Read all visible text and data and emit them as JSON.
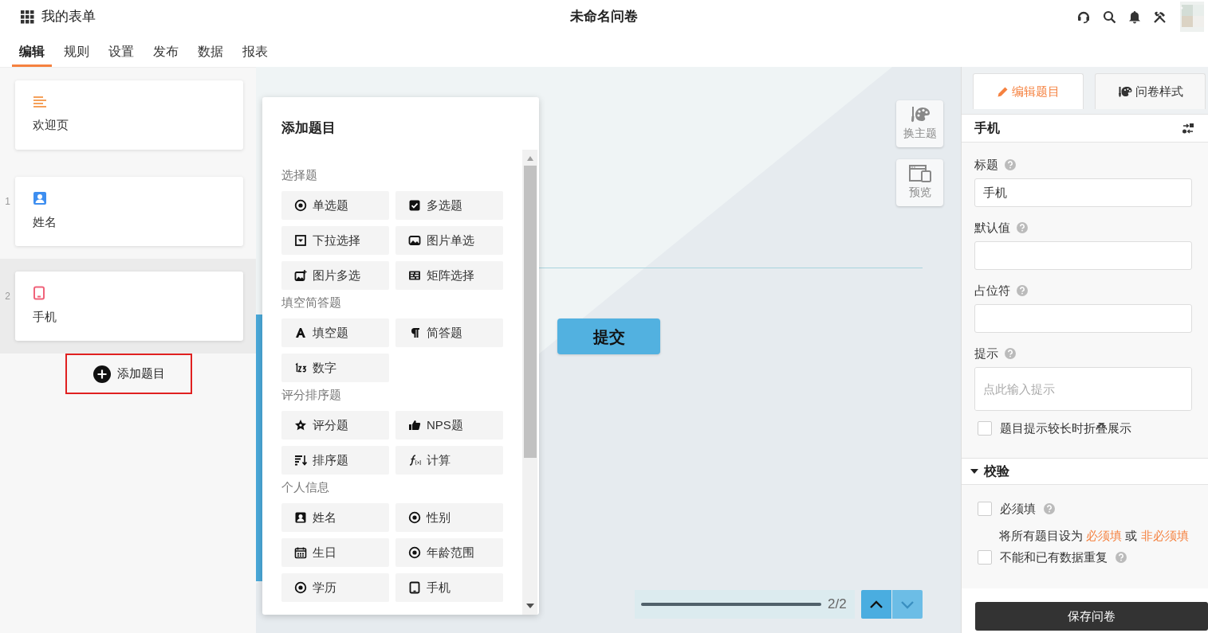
{
  "header": {
    "app_title": "我的表单",
    "survey_title": "未命名问卷"
  },
  "tabs": [
    {
      "label": "编辑",
      "selected": true
    },
    {
      "label": "规则",
      "selected": false
    },
    {
      "label": "设置",
      "selected": false
    },
    {
      "label": "发布",
      "selected": false
    },
    {
      "label": "数据",
      "selected": false
    },
    {
      "label": "报表",
      "selected": false
    }
  ],
  "pages": [
    {
      "kind": "welcome",
      "label": "欢迎页",
      "color": "#f5a05a",
      "selected": false
    },
    {
      "kind": "name",
      "number": "1",
      "label": "姓名",
      "color": "#3d8ef0",
      "selected": false
    },
    {
      "kind": "phone",
      "number": "2",
      "label": "手机",
      "color": "#f0637a",
      "selected": true
    }
  ],
  "add_button": "添加题目",
  "picker": {
    "title": "添加题目",
    "groups": [
      {
        "title": "选择题",
        "items": [
          {
            "kind": "radio",
            "label": "单选题"
          },
          {
            "kind": "checkbox",
            "label": "多选题"
          },
          {
            "kind": "dropdown",
            "label": "下拉选择"
          },
          {
            "kind": "image",
            "label": "图片单选"
          },
          {
            "kind": "images",
            "label": "图片多选"
          },
          {
            "kind": "matrix",
            "label": "矩阵选择"
          }
        ]
      },
      {
        "title": "填空简答题",
        "items": [
          {
            "kind": "text",
            "label": "填空题"
          },
          {
            "kind": "paragraph",
            "label": "简答题"
          },
          {
            "kind": "number",
            "label": "数字"
          }
        ]
      },
      {
        "title": "评分排序题",
        "items": [
          {
            "kind": "star",
            "label": "评分题"
          },
          {
            "kind": "thumb",
            "label": "NPS题"
          },
          {
            "kind": "sort",
            "label": "排序题"
          },
          {
            "kind": "formula",
            "label": "计算"
          }
        ]
      },
      {
        "title": "个人信息",
        "items": [
          {
            "kind": "person",
            "label": "姓名"
          },
          {
            "kind": "radio",
            "label": "性别"
          },
          {
            "kind": "calendar",
            "label": "生日"
          },
          {
            "kind": "radio",
            "label": "年龄范围"
          },
          {
            "kind": "radio",
            "label": "学历"
          },
          {
            "kind": "phone",
            "label": "手机"
          }
        ]
      }
    ]
  },
  "canvas": {
    "tools": [
      {
        "kind": "theme",
        "label": "换主题"
      },
      {
        "kind": "preview",
        "label": "预览"
      }
    ],
    "submit_button": "提交",
    "progress": {
      "level": 1,
      "reading": "2/2"
    },
    "pager": [
      {
        "kind": "up",
        "disabled": false
      },
      {
        "kind": "down",
        "disabled": true
      }
    ]
  },
  "editor": {
    "tabs": [
      {
        "kind": "edit",
        "label": "编辑题目",
        "selected": true
      },
      {
        "kind": "style",
        "label": "问卷样式",
        "selected": false
      }
    ],
    "question_title": "手机",
    "fields": [
      {
        "kind": "line",
        "label": "标题",
        "value": "手机"
      },
      {
        "kind": "line",
        "label": "默认值"
      },
      {
        "kind": "line",
        "label": "占位符"
      },
      {
        "kind": "area",
        "label": "提示",
        "placeholder": "点此输入提示"
      }
    ],
    "fold_option": {
      "label": "题目提示较长时折叠展示",
      "checked": false
    },
    "validation": {
      "title": "校验",
      "expanded": true,
      "required": {
        "label": "必须填",
        "checked": false
      },
      "note": {
        "text": "将所有题目设为",
        "link_required": "必须填",
        "joiner": "或",
        "link_optional": "非必须填"
      },
      "unique": {
        "label": "不能和已有数据重复",
        "checked": false
      }
    },
    "save_button": "保存问卷"
  }
}
